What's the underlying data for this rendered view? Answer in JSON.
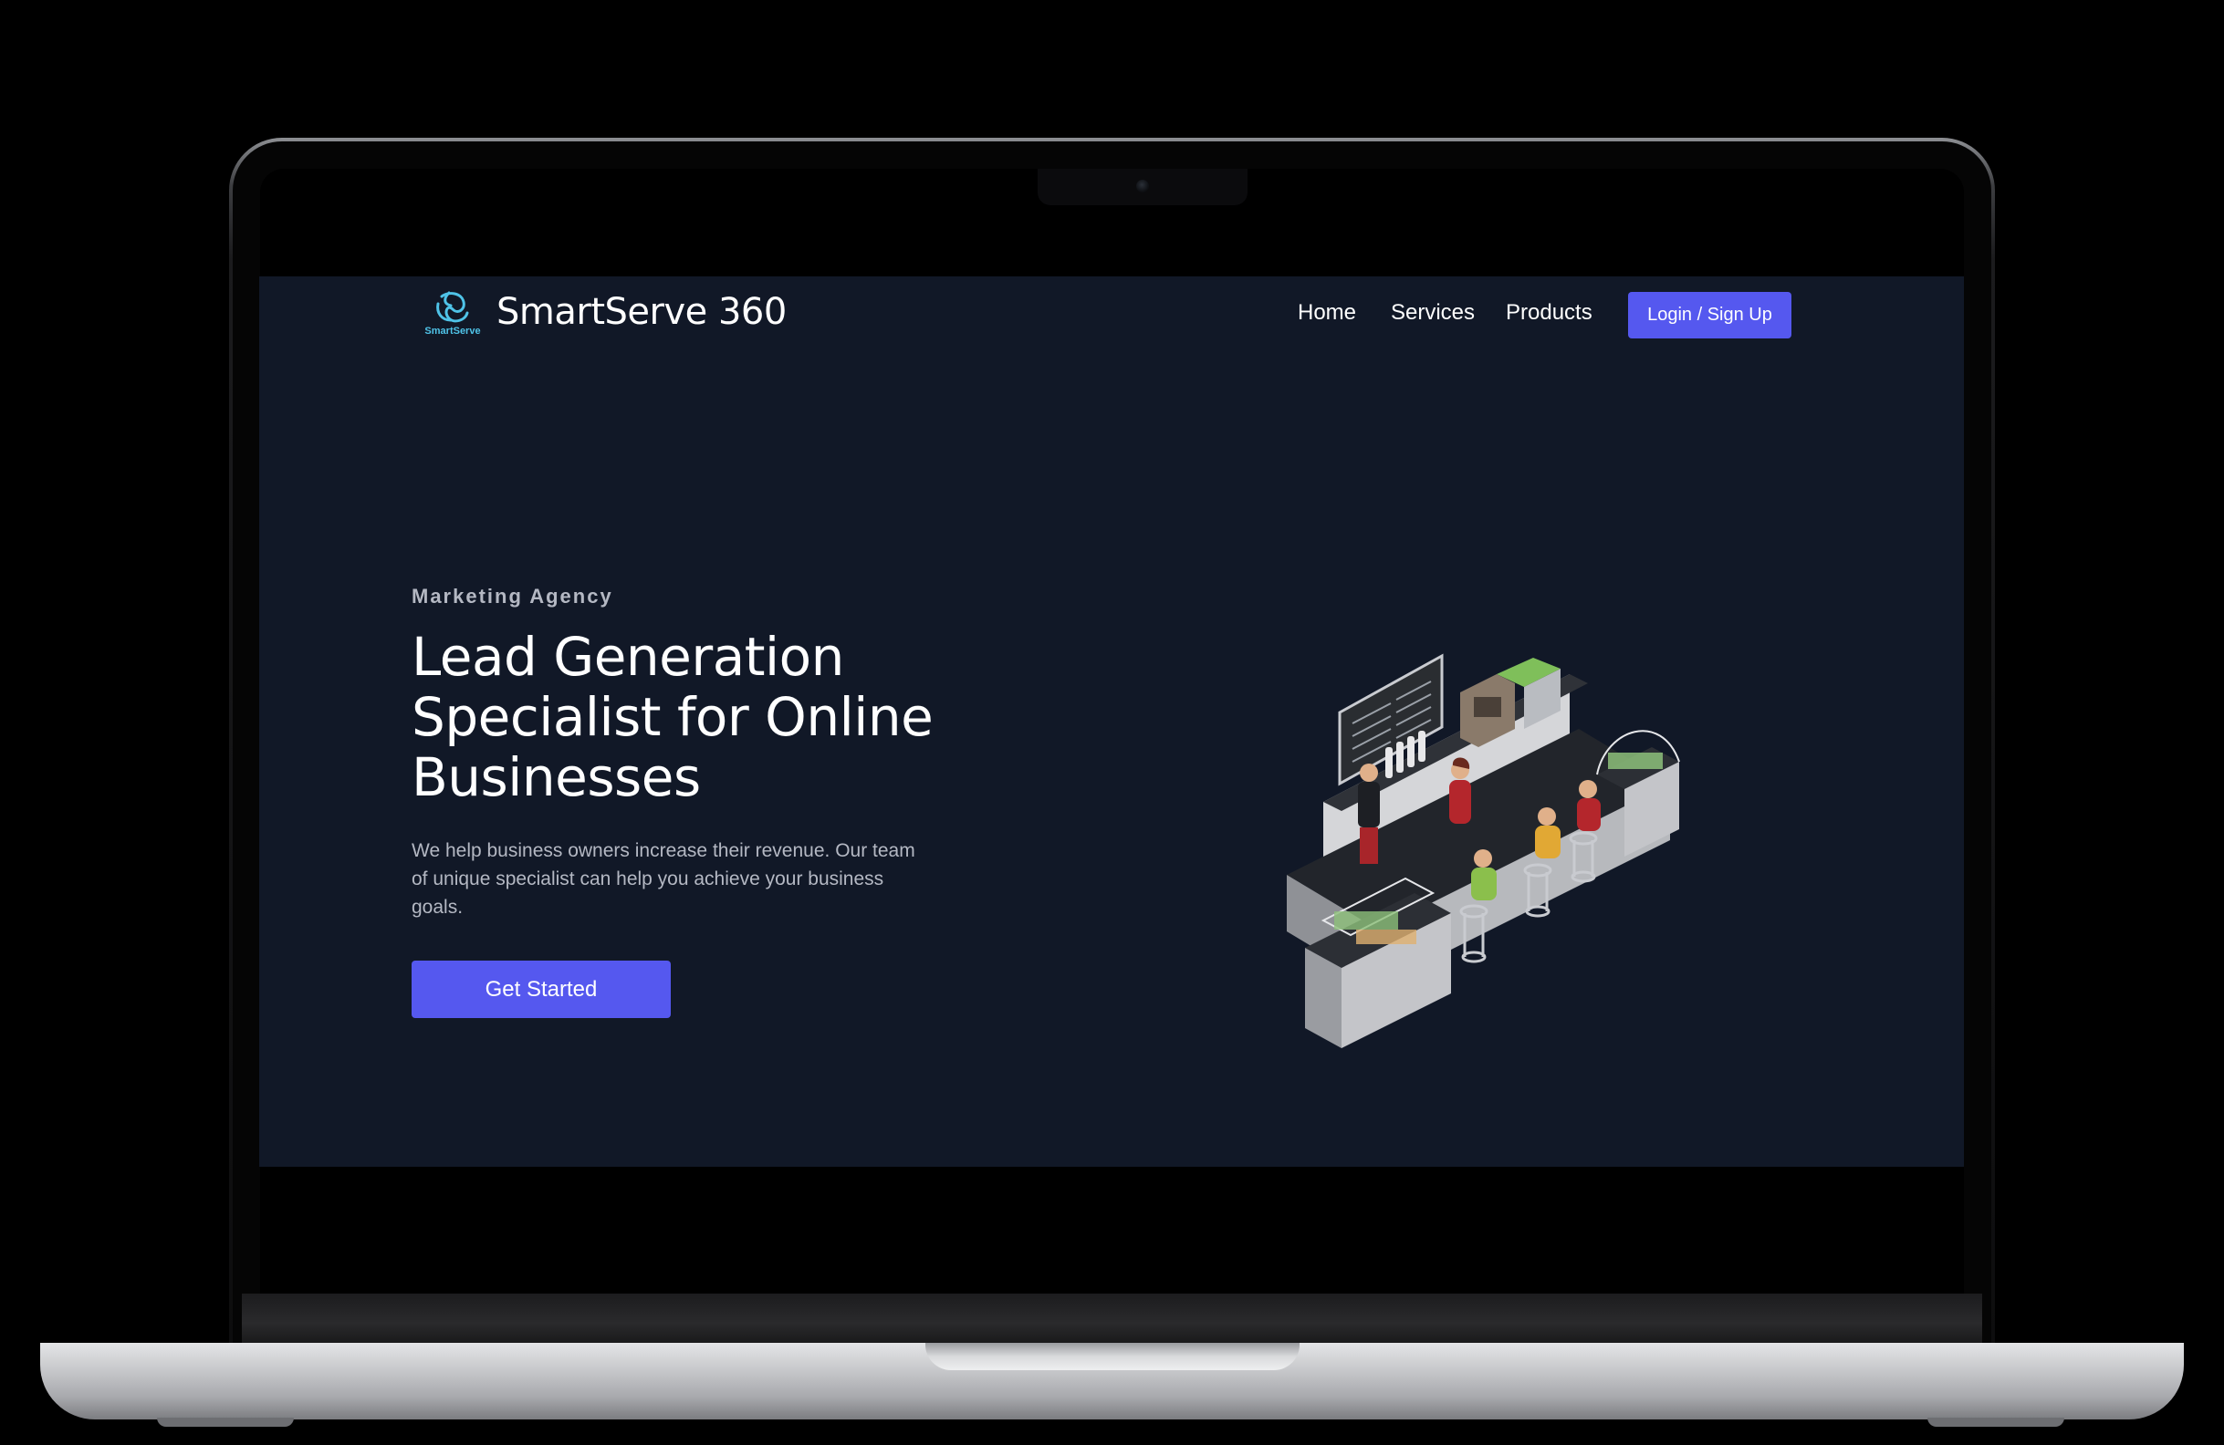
{
  "nav": {
    "logo_text": "SmartServe",
    "brand": "SmartServe 360",
    "links": [
      {
        "label": "Home"
      },
      {
        "label": "Services"
      },
      {
        "label": "Products"
      }
    ],
    "login_label": "Login / Sign Up"
  },
  "hero": {
    "eyebrow": "Marketing Agency",
    "title": "Lead Generation Specialist for Online Businesses",
    "description": "We help business owners increase their revenue. Our team of unique specialist can help you achieve your business goals.",
    "cta_label": "Get Started",
    "illustration_icon": "isometric-coffee-shop-illustration"
  },
  "colors": {
    "background": "#111827",
    "accent": "#5558ef",
    "text_primary": "#ffffff",
    "text_muted": "#b4b8c3",
    "logo": "#4fc3e8"
  }
}
